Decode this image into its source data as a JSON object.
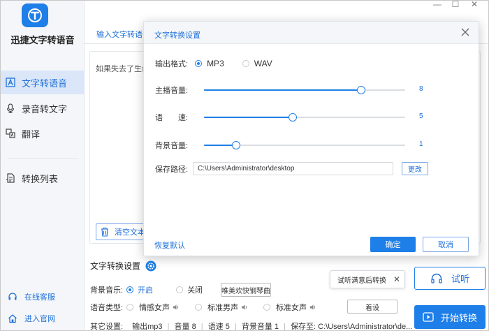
{
  "app": {
    "name": "迅捷文字转语音",
    "logo_letter": "T"
  },
  "window_controls": {
    "minimize": "—",
    "maximize": "☐",
    "close": "✕"
  },
  "sidebar": {
    "items": [
      {
        "label": "文字转语音",
        "icon": "text-a-icon",
        "active": true
      },
      {
        "label": "录音转文字",
        "icon": "microphone-icon",
        "active": false
      },
      {
        "label": "翻译",
        "icon": "translate-icon",
        "active": false
      },
      {
        "label": "转换列表",
        "icon": "list-icon",
        "active": false
      }
    ],
    "footer": {
      "support": "在线客服",
      "website": "进入官网"
    }
  },
  "main": {
    "tab_label": "输入文字转语音",
    "text_preview": "如果失去了生命",
    "clear_button": "清空文本",
    "settings_title": "文字转换设置",
    "bg_music": {
      "label": "背景音乐:",
      "on": "开启",
      "off": "关闭",
      "track_button": "唯美欢快钢琴曲",
      "selected": "on"
    },
    "voice_type": {
      "label": "语音类型:",
      "options": [
        "情感女声",
        "标准男声",
        "标准女声"
      ],
      "more_button": "着设"
    },
    "status_line": {
      "prefix": "其它设置:",
      "format": "输出mp3",
      "volume": "音量 8",
      "speed": "语速 5",
      "bg_volume": "背景音量 1",
      "save_to": "保存至: C:\\Users\\Administrator\\de..."
    },
    "tooltip": {
      "text": "试听满意后转换",
      "close": "✕"
    },
    "listen_button": "试听",
    "start_button": "开始转换"
  },
  "dialog": {
    "title": "文字转换设置",
    "format": {
      "label": "输出格式:",
      "options": [
        "MP3",
        "WAV"
      ],
      "selected": "MP3"
    },
    "host_volume": {
      "label": "主播音量:",
      "value": "8",
      "fraction": 0.78
    },
    "speed": {
      "label": "语　　速:",
      "value": "5",
      "fraction": 0.44
    },
    "bg_volume": {
      "label": "背景音量:",
      "value": "1",
      "fraction": 0.16
    },
    "save_path": {
      "label": "保存路径:",
      "value": "C:\\Users\\Administrator\\desktop",
      "change_button": "更改"
    },
    "reset_link": "恢复默认",
    "ok_button": "确定",
    "cancel_button": "取消"
  },
  "colors": {
    "accent": "#1e7fe8",
    "sidebar_bg": "#f4f6f9",
    "active_bg": "#dbe7f8"
  }
}
